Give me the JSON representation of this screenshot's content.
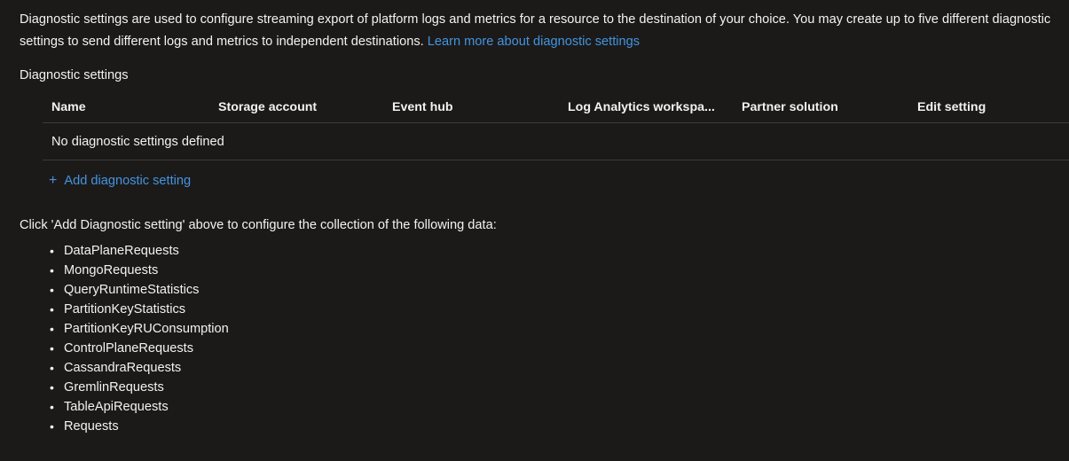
{
  "intro": {
    "text_before_link": "Diagnostic settings are used to configure streaming export of platform logs and metrics for a resource to the destination of your choice. You may create up to five different diagnostic settings to send different logs and metrics to independent destinations. ",
    "link_label": "Learn more about diagnostic settings"
  },
  "section": {
    "label": "Diagnostic settings"
  },
  "table": {
    "columns": [
      "Name",
      "Storage account",
      "Event hub",
      "Log Analytics workspa...",
      "Partner solution",
      "Edit setting"
    ],
    "empty_message": "No diagnostic settings defined"
  },
  "add_setting": {
    "icon": "plus-icon",
    "glyph": "+",
    "label": "Add diagnostic setting"
  },
  "instruction": {
    "text": "Click 'Add Diagnostic setting' above to configure the collection of the following data:"
  },
  "data_types": [
    "DataPlaneRequests",
    "MongoRequests",
    "QueryRuntimeStatistics",
    "PartitionKeyStatistics",
    "PartitionKeyRUConsumption",
    "ControlPlaneRequests",
    "CassandraRequests",
    "GremlinRequests",
    "TableApiRequests",
    "Requests"
  ],
  "colors": {
    "background": "#1b1a19",
    "text": "#f3f2f1",
    "link": "#4494df",
    "border": "#3b3a39"
  }
}
